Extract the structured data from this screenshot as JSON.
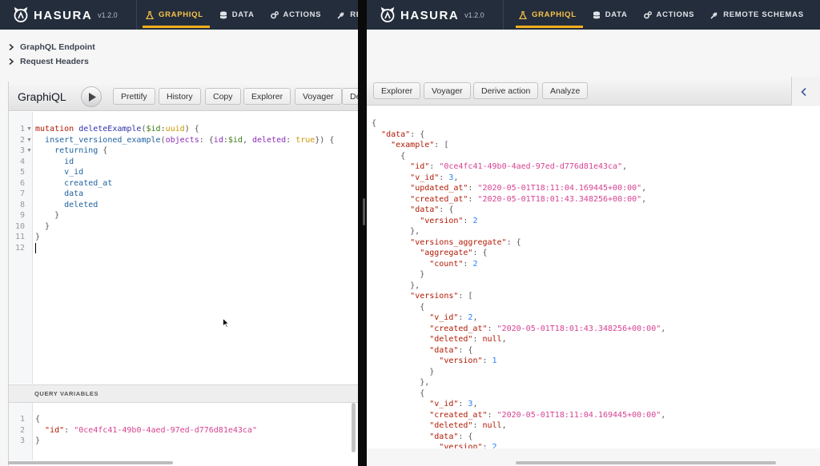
{
  "left_nav": {
    "brand": "HASURA",
    "version": "v1.2.0",
    "items": [
      {
        "label": "GRAPHIQL",
        "icon": "flask-icon",
        "active": true
      },
      {
        "label": "DATA",
        "icon": "database-icon",
        "active": false
      },
      {
        "label": "ACTIONS",
        "icon": "cogs-icon",
        "active": false
      },
      {
        "label": "RE",
        "icon": "plug-icon",
        "active": false
      }
    ]
  },
  "right_nav": {
    "brand": "HASURA",
    "version": "v1.2.0",
    "items": [
      {
        "label": "GRAPHIQL",
        "icon": "flask-icon",
        "active": true
      },
      {
        "label": "DATA",
        "icon": "database-icon",
        "active": false
      },
      {
        "label": "ACTIONS",
        "icon": "cogs-icon",
        "active": false
      },
      {
        "label": "REMOTE SCHEMAS",
        "icon": "plug-icon",
        "active": false
      },
      {
        "label": "",
        "icon": "cloud-icon",
        "active": false
      }
    ]
  },
  "collapsibles": [
    {
      "label": "GraphQL Endpoint"
    },
    {
      "label": "Request Headers"
    }
  ],
  "graphiql": {
    "title": "GraphiQL",
    "toolbar": [
      "Prettify",
      "History",
      "Copy",
      "Explorer",
      "Voyager",
      "De"
    ]
  },
  "query_lines": [
    {
      "n": "1",
      "fold": true,
      "tokens": [
        {
          "c": "kw",
          "t": "mutation "
        },
        {
          "c": "def",
          "t": "deleteExample"
        },
        {
          "c": "p",
          "t": "("
        },
        {
          "c": "var",
          "t": "$id"
        },
        {
          "c": "p",
          "t": ":"
        },
        {
          "c": "typ",
          "t": "uuid"
        },
        {
          "c": "p",
          "t": ") {"
        }
      ]
    },
    {
      "n": "2",
      "fold": true,
      "tokens": [
        {
          "c": "p",
          "t": "  "
        },
        {
          "c": "fld",
          "t": "insert_versioned_example"
        },
        {
          "c": "p",
          "t": "("
        },
        {
          "c": "atr",
          "t": "objects"
        },
        {
          "c": "p",
          "t": ": {"
        },
        {
          "c": "atr",
          "t": "id"
        },
        {
          "c": "p",
          "t": ":"
        },
        {
          "c": "var",
          "t": "$id"
        },
        {
          "c": "p",
          "t": ", "
        },
        {
          "c": "atr",
          "t": "deleted"
        },
        {
          "c": "p",
          "t": ": "
        },
        {
          "c": "bool",
          "t": "true"
        },
        {
          "c": "p",
          "t": "}) {"
        }
      ]
    },
    {
      "n": "3",
      "fold": true,
      "tokens": [
        {
          "c": "p",
          "t": "    "
        },
        {
          "c": "fld",
          "t": "returning"
        },
        {
          "c": "p",
          "t": " {"
        }
      ]
    },
    {
      "n": "4",
      "fold": false,
      "tokens": [
        {
          "c": "p",
          "t": "      "
        },
        {
          "c": "fld",
          "t": "id"
        }
      ]
    },
    {
      "n": "5",
      "fold": false,
      "tokens": [
        {
          "c": "p",
          "t": "      "
        },
        {
          "c": "fld",
          "t": "v_id"
        }
      ]
    },
    {
      "n": "6",
      "fold": false,
      "tokens": [
        {
          "c": "p",
          "t": "      "
        },
        {
          "c": "fld",
          "t": "created_at"
        }
      ]
    },
    {
      "n": "7",
      "fold": false,
      "tokens": [
        {
          "c": "p",
          "t": "      "
        },
        {
          "c": "fld",
          "t": "data"
        }
      ]
    },
    {
      "n": "8",
      "fold": false,
      "tokens": [
        {
          "c": "p",
          "t": "      "
        },
        {
          "c": "fld",
          "t": "deleted"
        }
      ]
    },
    {
      "n": "9",
      "fold": false,
      "tokens": [
        {
          "c": "p",
          "t": "    }"
        }
      ]
    },
    {
      "n": "10",
      "fold": false,
      "tokens": [
        {
          "c": "p",
          "t": "  }"
        }
      ]
    },
    {
      "n": "11",
      "fold": false,
      "tokens": [
        {
          "c": "p",
          "t": "}"
        }
      ]
    },
    {
      "n": "12",
      "fold": false,
      "tokens": []
    }
  ],
  "query_variables": {
    "title": "QUERY VARIABLES",
    "lines": [
      {
        "n": "1",
        "tokens": [
          {
            "c": "p",
            "t": "{"
          }
        ]
      },
      {
        "n": "2",
        "tokens": [
          {
            "c": "p",
            "t": "  "
          },
          {
            "c": "k",
            "t": "\"id\""
          },
          {
            "c": "p",
            "t": ": "
          },
          {
            "c": "s",
            "t": "\"0ce4fc41-49b0-4aed-97ed-d776d81e43ca\""
          }
        ]
      },
      {
        "n": "3",
        "tokens": [
          {
            "c": "p",
            "t": "}"
          }
        ]
      }
    ]
  },
  "right_toolbar": [
    "Explorer",
    "Voyager",
    "Derive action",
    "Analyze"
  ],
  "result_lines": [
    [
      {
        "c": "p",
        "t": "{"
      }
    ],
    [
      {
        "c": "p",
        "t": "  "
      },
      {
        "c": "k",
        "t": "\"data\""
      },
      {
        "c": "p",
        "t": ": {"
      }
    ],
    [
      {
        "c": "p",
        "t": "    "
      },
      {
        "c": "k",
        "t": "\"example\""
      },
      {
        "c": "p",
        "t": ": ["
      }
    ],
    [
      {
        "c": "p",
        "t": "      {"
      }
    ],
    [
      {
        "c": "p",
        "t": "        "
      },
      {
        "c": "k",
        "t": "\"id\""
      },
      {
        "c": "p",
        "t": ": "
      },
      {
        "c": "s",
        "t": "\"0ce4fc41-49b0-4aed-97ed-d776d81e43ca\""
      },
      {
        "c": "p",
        "t": ","
      }
    ],
    [
      {
        "c": "p",
        "t": "        "
      },
      {
        "c": "k",
        "t": "\"v_id\""
      },
      {
        "c": "p",
        "t": ": "
      },
      {
        "c": "n",
        "t": "3"
      },
      {
        "c": "p",
        "t": ","
      }
    ],
    [
      {
        "c": "p",
        "t": "        "
      },
      {
        "c": "k",
        "t": "\"updated_at\""
      },
      {
        "c": "p",
        "t": ": "
      },
      {
        "c": "s",
        "t": "\"2020-05-01T18:11:04.169445+00:00\""
      },
      {
        "c": "p",
        "t": ","
      }
    ],
    [
      {
        "c": "p",
        "t": "        "
      },
      {
        "c": "k",
        "t": "\"created_at\""
      },
      {
        "c": "p",
        "t": ": "
      },
      {
        "c": "s",
        "t": "\"2020-05-01T18:01:43.348256+00:00\""
      },
      {
        "c": "p",
        "t": ","
      }
    ],
    [
      {
        "c": "p",
        "t": "        "
      },
      {
        "c": "k",
        "t": "\"data\""
      },
      {
        "c": "p",
        "t": ": {"
      }
    ],
    [
      {
        "c": "p",
        "t": "          "
      },
      {
        "c": "k",
        "t": "\"version\""
      },
      {
        "c": "p",
        "t": ": "
      },
      {
        "c": "n",
        "t": "2"
      }
    ],
    [
      {
        "c": "p",
        "t": "        },"
      }
    ],
    [
      {
        "c": "p",
        "t": "        "
      },
      {
        "c": "k",
        "t": "\"versions_aggregate\""
      },
      {
        "c": "p",
        "t": ": {"
      }
    ],
    [
      {
        "c": "p",
        "t": "          "
      },
      {
        "c": "k",
        "t": "\"aggregate\""
      },
      {
        "c": "p",
        "t": ": {"
      }
    ],
    [
      {
        "c": "p",
        "t": "            "
      },
      {
        "c": "k",
        "t": "\"count\""
      },
      {
        "c": "p",
        "t": ": "
      },
      {
        "c": "n",
        "t": "2"
      }
    ],
    [
      {
        "c": "p",
        "t": "          }"
      }
    ],
    [
      {
        "c": "p",
        "t": "        },"
      }
    ],
    [
      {
        "c": "p",
        "t": "        "
      },
      {
        "c": "k",
        "t": "\"versions\""
      },
      {
        "c": "p",
        "t": ": ["
      }
    ],
    [
      {
        "c": "p",
        "t": "          {"
      }
    ],
    [
      {
        "c": "p",
        "t": "            "
      },
      {
        "c": "k",
        "t": "\"v_id\""
      },
      {
        "c": "p",
        "t": ": "
      },
      {
        "c": "n",
        "t": "2"
      },
      {
        "c": "p",
        "t": ","
      }
    ],
    [
      {
        "c": "p",
        "t": "            "
      },
      {
        "c": "k",
        "t": "\"created_at\""
      },
      {
        "c": "p",
        "t": ": "
      },
      {
        "c": "s",
        "t": "\"2020-05-01T18:01:43.348256+00:00\""
      },
      {
        "c": "p",
        "t": ","
      }
    ],
    [
      {
        "c": "p",
        "t": "            "
      },
      {
        "c": "k",
        "t": "\"deleted\""
      },
      {
        "c": "p",
        "t": ": "
      },
      {
        "c": "k",
        "t": "null"
      },
      {
        "c": "p",
        "t": ","
      }
    ],
    [
      {
        "c": "p",
        "t": "            "
      },
      {
        "c": "k",
        "t": "\"data\""
      },
      {
        "c": "p",
        "t": ": {"
      }
    ],
    [
      {
        "c": "p",
        "t": "              "
      },
      {
        "c": "k",
        "t": "\"version\""
      },
      {
        "c": "p",
        "t": ": "
      },
      {
        "c": "n",
        "t": "1"
      }
    ],
    [
      {
        "c": "p",
        "t": "            }"
      }
    ],
    [
      {
        "c": "p",
        "t": "          },"
      }
    ],
    [
      {
        "c": "p",
        "t": "          {"
      }
    ],
    [
      {
        "c": "p",
        "t": "            "
      },
      {
        "c": "k",
        "t": "\"v_id\""
      },
      {
        "c": "p",
        "t": ": "
      },
      {
        "c": "n",
        "t": "3"
      },
      {
        "c": "p",
        "t": ","
      }
    ],
    [
      {
        "c": "p",
        "t": "            "
      },
      {
        "c": "k",
        "t": "\"created_at\""
      },
      {
        "c": "p",
        "t": ": "
      },
      {
        "c": "s",
        "t": "\"2020-05-01T18:11:04.169445+00:00\""
      },
      {
        "c": "p",
        "t": ","
      }
    ],
    [
      {
        "c": "p",
        "t": "            "
      },
      {
        "c": "k",
        "t": "\"deleted\""
      },
      {
        "c": "p",
        "t": ": "
      },
      {
        "c": "k",
        "t": "null"
      },
      {
        "c": "p",
        "t": ","
      }
    ],
    [
      {
        "c": "p",
        "t": "            "
      },
      {
        "c": "k",
        "t": "\"data\""
      },
      {
        "c": "p",
        "t": ": {"
      }
    ],
    [
      {
        "c": "p",
        "t": "              "
      },
      {
        "c": "k",
        "t": "\"version\""
      },
      {
        "c": "p",
        "t": ": "
      },
      {
        "c": "n",
        "t": "2"
      }
    ]
  ]
}
